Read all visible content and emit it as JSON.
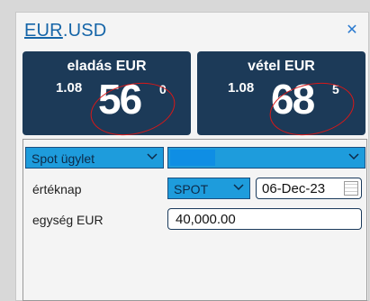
{
  "header": {
    "base": "EUR",
    "separator": ".",
    "quote": "USD"
  },
  "sell": {
    "label": "eladás EUR",
    "prefix": "1.08",
    "big": "56",
    "sup": "0"
  },
  "buy": {
    "label": "vétel EUR",
    "prefix": "1.08",
    "big": "68",
    "sup": "5"
  },
  "form": {
    "product_select": "Spot ügylet",
    "value_date_label": "értéknap",
    "tenor_select": "SPOT",
    "value_date": "06-Dec-23",
    "amount_label": "egység EUR",
    "amount": "40,000.00"
  },
  "colors": {
    "tile": "#1c3a58",
    "accent": "#1e9cdc",
    "annotation": "#d81818"
  }
}
